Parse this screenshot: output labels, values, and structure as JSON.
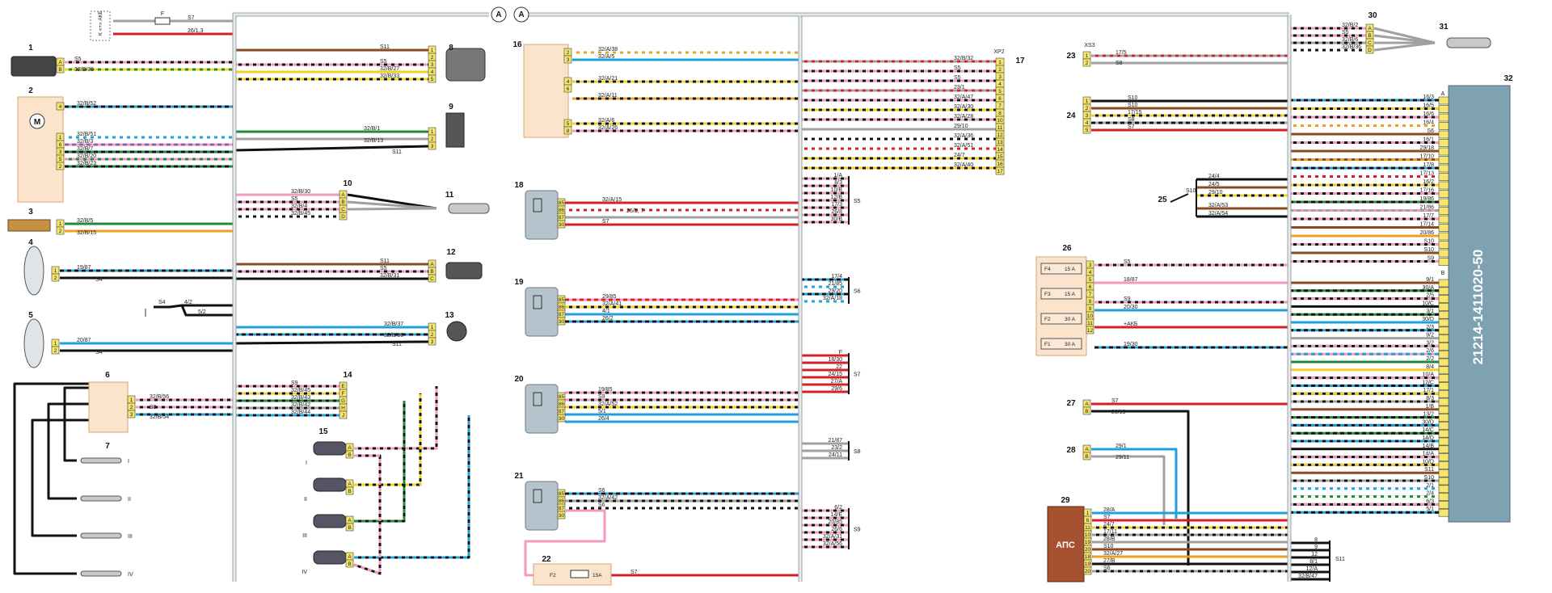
{
  "diagram": {
    "ecu_label": "21214-1411020-50",
    "ecu_number": "32",
    "aps_label": "АПС",
    "colors": {
      "bus": "#9aa3a8",
      "connector": "#f6e66e",
      "relay_fill": "#b5c3cc",
      "module_fill": "#fbe3cc",
      "ecu_fill": "#7fa2b3",
      "aps_fill": "#a5502e",
      "wire_red": "#d62027",
      "wire_blue": "#1ea0dc",
      "wire_brown": "#8a4b22",
      "wire_black": "#111111",
      "wire_yellow": "#f0d020",
      "wire_green": "#1f8a3a",
      "wire_pink": "#f29ac0",
      "wire_orange": "#f0a020",
      "wire_grey": "#a0a0a0",
      "wire_violet": "#8a60b0"
    },
    "component_numbers": [
      "1",
      "2",
      "3",
      "4",
      "5",
      "6",
      "7",
      "8",
      "9",
      "10",
      "11",
      "12",
      "13",
      "14",
      "15",
      "16",
      "17",
      "18",
      "19",
      "20",
      "21",
      "22",
      "23",
      "24",
      "25",
      "26",
      "27",
      "28",
      "29",
      "30",
      "31",
      "32"
    ],
    "bus_marker": "A",
    "left_labels": {
      "top_s7": "S7",
      "top_26_1_3": "26/1,3",
      "top_f": "F",
      "top_k_akb": "К «+» АКБ",
      "c1": [
        "S5",
        "32/B/35"
      ],
      "c2": [
        "32/B/52",
        "32/B/51",
        "32/B/3",
        "32/B/7",
        "32/B/20",
        "32/B/23"
      ],
      "c3": [
        "32/B/5",
        "32/B/15"
      ],
      "c4": [
        "19/87",
        "S4"
      ],
      "c5": [
        "20/87",
        "S4"
      ],
      "c6": [
        "32/B/56",
        "S9",
        "32/B/54"
      ],
      "s4_group": [
        "S4",
        "4/2",
        "5/2"
      ],
      "spark_plugs": [
        "I",
        "II",
        "III",
        "IV"
      ]
    },
    "mid_left_labels": {
      "c8": [
        "S11",
        "S5",
        "32/B/27",
        "32/B/33"
      ],
      "c9": [
        "32/B/1",
        "32/B/13",
        "S11"
      ],
      "c10": [
        "32/B/30",
        "S5",
        "32/B/4",
        "32/B/45"
      ],
      "c12": [
        "S11",
        "S5",
        "32/B/31"
      ],
      "c13": [
        "32/B/37",
        "32/B/36",
        "S11"
      ],
      "c14": [
        "S9",
        "32/B/45",
        "32/B/43",
        "32/B/42",
        "32/B/44"
      ],
      "c15_cyl": [
        "I",
        "II",
        "III",
        "IV"
      ]
    },
    "center_labels": {
      "c16": [
        "32/A/38",
        "32/A/5",
        "32/A/21",
        "32/A/11",
        "32/A/6",
        "32/A/26"
      ],
      "c17_title": "XP2",
      "c17_num": "17",
      "c17": [
        "32/B/32",
        "S5",
        "S5",
        "23/1",
        "32/A/47",
        "32/A/30",
        "32/A/28",
        "29/10",
        "32/A/36",
        "32/A/51",
        "24/7",
        "32/A/40"
      ],
      "c18": [
        "32/A/15",
        "26/5, 7",
        "S7"
      ],
      "c19": [
        "29/85",
        "32/A/41",
        "4/1",
        "26/2"
      ],
      "c20": [
        "19/85",
        "S9",
        "32/A/52",
        "5/1",
        "26/4"
      ],
      "c21": [
        "S6",
        "32/A/42",
        "S6"
      ],
      "c22_fuse": "F2",
      "c22_amp": "15A",
      "c22_out": "S7",
      "s5_group": [
        "1/A",
        "8/3",
        "10/B",
        "12/B",
        "17/3",
        "26/8",
        "30/B"
      ],
      "s5_name": "S5",
      "s6_group": [
        "17/4",
        "21/85",
        "29/20",
        "32/A/18"
      ],
      "s6_name": "S6",
      "s7_group": [
        "F",
        "18/30",
        "22",
        "24/15",
        "27/A",
        "29/6"
      ],
      "s7_name": "S7",
      "s8_group": [
        "21/87",
        "23/2",
        "24/11"
      ],
      "s8_name": "S8",
      "s9_group": [
        "6/2",
        "14/E",
        "20/85",
        "26/6",
        "32/A/31",
        "32/A/56"
      ],
      "s9_name": "S9"
    },
    "right_labels": {
      "c23_title": "XS3",
      "c23": [
        "17/5",
        "S8"
      ],
      "c24": [
        "S10",
        "S10",
        "17/15",
        "S8",
        "S7"
      ],
      "c25": [
        "S10",
        "24/4",
        "24/5",
        "29/10",
        "32/A/53",
        "32/A/54",
        "32/B/50"
      ],
      "c26_fuses": [
        {
          "name": "F4",
          "amp": "15 A"
        },
        {
          "name": "F3",
          "amp": "15 A"
        },
        {
          "name": "F2",
          "amp": "30 A"
        },
        {
          "name": "F1",
          "amp": "30 A"
        }
      ],
      "c26": [
        "S5",
        "18/87",
        "S9",
        "20/30",
        "+АКБ",
        "19/30"
      ],
      "c27": [
        "S7",
        "29/19"
      ],
      "c28": [
        "29/1",
        "29/11"
      ],
      "c29": [
        "28/A",
        "S7",
        "24/7",
        "17/11",
        "28/B",
        "S10",
        "32/A/27",
        "27/B",
        "S6"
      ],
      "c30": [
        "32/B/2",
        "S5",
        "32/B/6",
        "32/B/36"
      ],
      "s11_group": [
        "8",
        "9",
        "12",
        "8/1",
        "12/A",
        "32/B/47"
      ],
      "s11_name": "S11",
      "ecu_a_pins": [
        "16/3",
        "16/5",
        "16/6",
        "16/4",
        "S6",
        "16/1",
        "29/18",
        "17/10",
        "17/8",
        "17/13",
        "16/2",
        "17/16",
        "19/86",
        "21/86",
        "17/7",
        "17/14",
        "20/86",
        "S10",
        "S10",
        "S9"
      ],
      "ecu_b_pins": [
        "9/1",
        "30/A",
        "2/5",
        "10/C",
        "3/1",
        "30/D",
        "2/3",
        "9/2",
        "3/2",
        "2/6",
        "2/2",
        "8/4",
        "10/A",
        "12/C",
        "17/1",
        "8/3",
        "1/B",
        "13/2",
        "30/D",
        "14/C",
        "14/D",
        "14/B",
        "14/A",
        "10/D",
        "S11",
        "S10",
        "2/1",
        "2/4",
        "6/3",
        "5/1"
      ]
    }
  }
}
